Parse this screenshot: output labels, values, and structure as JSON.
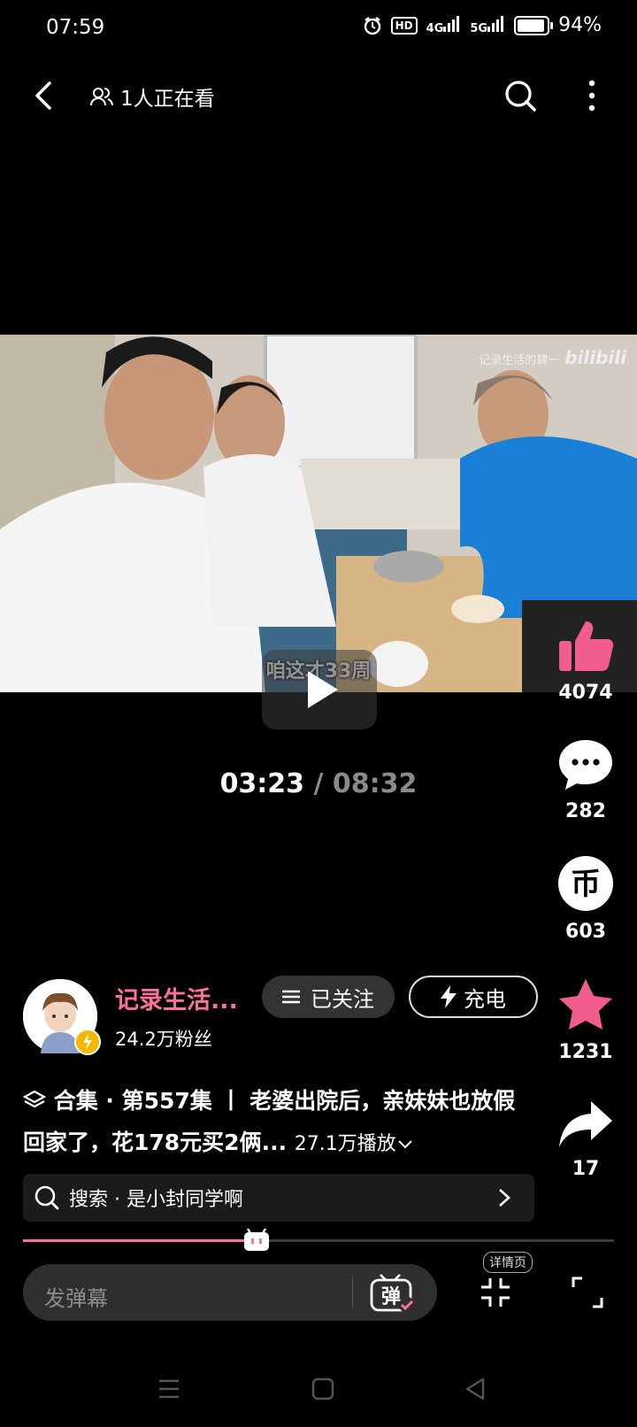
{
  "status": {
    "time": "07:59",
    "hd": "HD",
    "net1": "4G",
    "net2": "5G",
    "battery": "94%",
    "battery_level": 0.94
  },
  "topbar": {
    "viewers": "1人正在看"
  },
  "video": {
    "watermark_text": "记录生活的肆一",
    "watermark_logo": "bilibili",
    "subtitle": "咱这才33周"
  },
  "time": {
    "current": "03:23",
    "separator": " / ",
    "total": "08:32"
  },
  "rail": {
    "likes": "4074",
    "comments": "282",
    "coins": "603",
    "favorites": "1231",
    "shares": "17",
    "coin_glyph": "币"
  },
  "author": {
    "name": "记录生活...",
    "followers": "24.2万粉丝",
    "follow_label": "已关注",
    "charge_label": "充电"
  },
  "description": {
    "prefix": "合集 · 第557集 丨 老婆出院后，亲妹妹也放假回家了，花178元买2俩...",
    "plays": "27.1万播放"
  },
  "search": {
    "label": "搜索 · 是小封同学啊"
  },
  "player": {
    "progress": 0.4,
    "danmaku_placeholder": "发弹幕",
    "danmaku_toggle": "弹",
    "detail_label": "详情页"
  },
  "colors": {
    "accent": "#fb7299",
    "like": "#f25d8e"
  }
}
